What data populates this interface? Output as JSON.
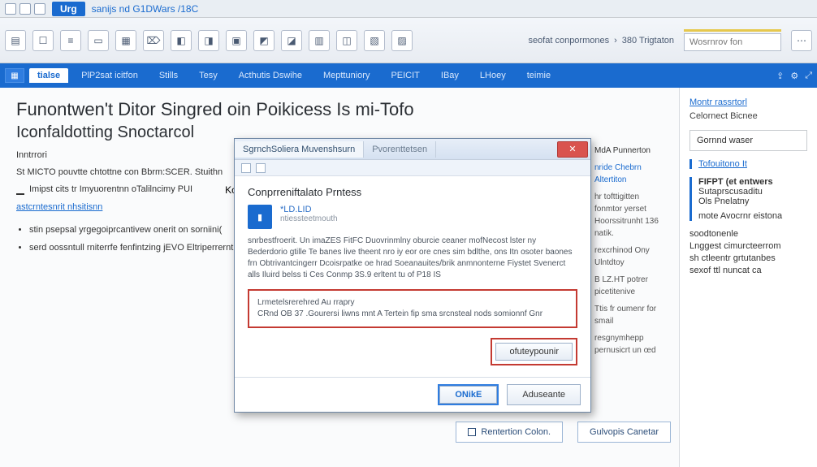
{
  "chrome": {
    "url_chip": "Urg",
    "url_text": "sanijs nd G1DWars /18C"
  },
  "toolbar": {
    "crumb1": "seofat conpormones",
    "crumb2": "380 Trigtaton",
    "search_placeholder": "Wosrnrov fon"
  },
  "ribbon": {
    "tabs": [
      "tialse",
      "PlP2sat icitfon",
      "Stills",
      "Tesy",
      "Acthutis Dswihe",
      "Mepttuniory",
      "PEICIT",
      "IBay",
      "LHoey",
      "teimie"
    ],
    "active_index": 0
  },
  "main": {
    "title": "Funontwen't Ditor Singred oin Poikicess Is mi-Tofo",
    "subtitle": "Iconfaldotting Snoctarcol",
    "label_small": "Inntrrori",
    "line1_left": "St MICTO pouvtte chtottne con Bbrm:SCER. Stuithn",
    "row2_icon_text": "Imipst cits tr Imyuorentnn oTalilncimy PUI",
    "row2_right": "Konnonitcns CEIOQ",
    "row3_link": "astcrntesnrit nhsitisnn",
    "bullets": [
      "stin psepsal yrgegoiprcantivew onerit on sorniini(",
      "serd oossntull rniterrfe fenfintzing jEVO Eltriperrernt pm parattonm, fit inche estwer ilinort gblt apecr"
    ],
    "btn_left": "Rentertion Colon.",
    "btn_right": "Gulvopis Canetar"
  },
  "midpanel": {
    "h": "MdA Punnerton",
    "items": [
      "nride Chebrn Altertiton",
      "hr tofttigitten fonmtor yerset Hoorssitrunht 136 natik.",
      "rexcrhinod Ony Ulntdtoy",
      "B LZ.HT potrer picetitenive",
      "Ttis fr oumenr for smail",
      "resgnymhepp pernusicrt un œd"
    ]
  },
  "sidebar": {
    "link": "Montr rassrtorl",
    "note": "Celornect Bicnee",
    "box": "Gornnd waser",
    "accent_link": "Tofouitono It",
    "grp_title": "FIFPT (et entwers",
    "grp_items": [
      "Sutaprscusaditu",
      "Ols Pnelatny",
      "mote Avocrnr eistona"
    ],
    "list": [
      "soodtonenle",
      "Lnggest cimurcteerrom",
      "sh ctleentr grtutanbes",
      "sexof ttl nuncat ca"
    ]
  },
  "dialog": {
    "tab1": "SgrnchSoliera Muvenshsurn",
    "tab2": "Pvorenttetsen",
    "heading": "Conprreniftalato Prntess",
    "badge": "▮",
    "label": "*LD.LID",
    "sub": "ntiessteetmouth",
    "body": "snrbestfroerit. Un imaZES FitFC Duovrinmlny oburcie ceaner mofNecost lster ny Bederdorio gtille Te banes live theent nro iy eor ore cnes sim bdlthe, ons Itn osoter baones frn Obtrivantcingerr Dcoisrpatke oe hrad Soeanauites/brik anmnonterne Fiystet Svenerct alls Iluird belss ti Ces Conmp 3S.9 erltent tu of P18 IS",
    "red_box_l1": "Lrmetelsrerehred Au rrapry",
    "red_box_l2": "CRnd OB 37 .Gourersi liwns mnt A Tertein fip sma srcnsteal nods somionnf Gnr",
    "btn_mid": "ofuteypounir",
    "btn_ok": "ONikE",
    "btn_cancel": "Aduseante"
  }
}
